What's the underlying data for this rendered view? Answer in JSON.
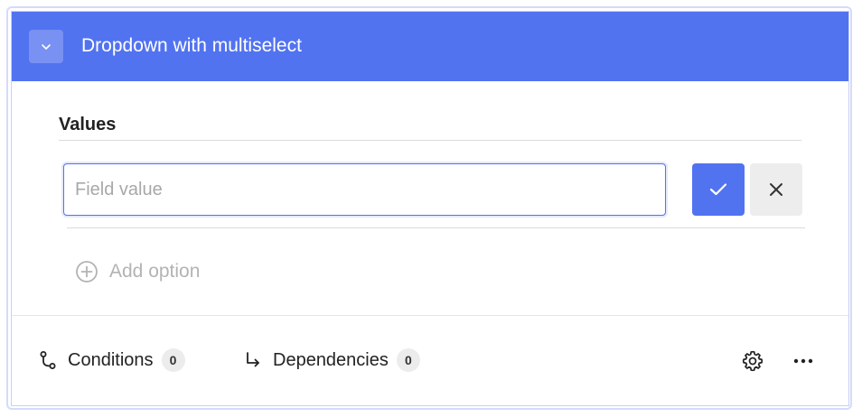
{
  "header": {
    "title": "Dropdown with multiselect",
    "collapse_icon": "chevron-down-icon",
    "background_color": "#5273f0"
  },
  "values_section": {
    "label": "Values",
    "field": {
      "value": "",
      "placeholder": "Field value"
    },
    "confirm_icon": "check-icon",
    "cancel_icon": "close-icon",
    "add_option_label": "Add option",
    "add_option_icon": "plus-circle-icon"
  },
  "footer": {
    "conditions": {
      "label": "Conditions",
      "count": "0",
      "icon": "branch-icon"
    },
    "dependencies": {
      "label": "Dependencies",
      "count": "0",
      "icon": "arrow-turn-right-icon"
    },
    "settings_icon": "gear-icon",
    "more_icon": "ellipsis-icon"
  },
  "colors": {
    "accent": "#5273f0",
    "cancel_bg": "#ededed",
    "badge_bg": "#ececec"
  }
}
